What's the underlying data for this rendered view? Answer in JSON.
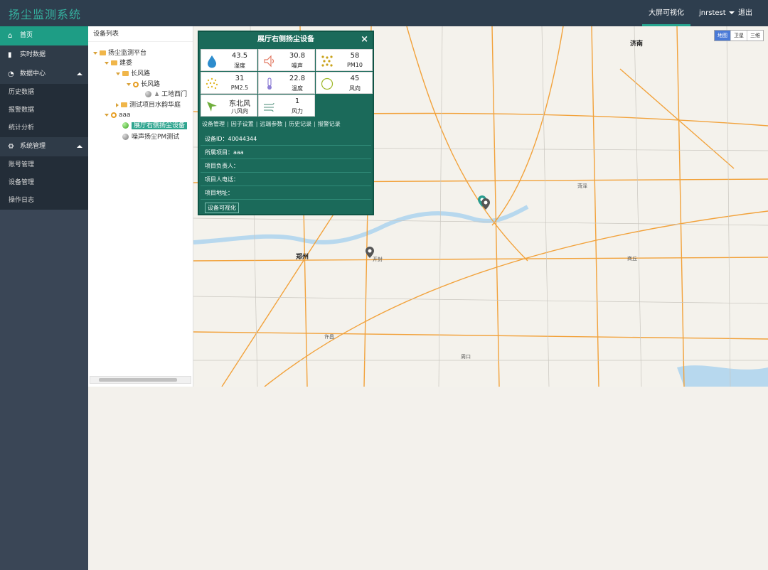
{
  "app": {
    "title": "扬尘监测系统"
  },
  "top": {
    "screen": "大屏可视化",
    "user": "jnrstest",
    "logout": "退出"
  },
  "sidebar": {
    "items": [
      {
        "label": "首页",
        "icon": "home-icon",
        "active": true
      },
      {
        "label": "实时数据",
        "icon": "bar-chart-icon"
      },
      {
        "label": "数据中心",
        "icon": "pie-chart-icon",
        "group": true
      },
      {
        "label": "历史数据",
        "sub": true
      },
      {
        "label": "报警数据",
        "sub": true
      },
      {
        "label": "统计分析",
        "sub": true
      },
      {
        "label": "系统管理",
        "icon": "gear-icon",
        "group": true
      },
      {
        "label": "账号管理",
        "sub": true
      },
      {
        "label": "设备管理",
        "sub": true
      },
      {
        "label": "操作日志",
        "sub": true
      }
    ]
  },
  "devices": {
    "title": "设备列表",
    "tree": [
      "扬尘监测平台",
      "建委",
      "长风路",
      "长风路",
      "工地西门",
      "测试项目水韵华庭",
      "aaa",
      "展厅右侧扬尘设备",
      "噪声扬尘PM测试"
    ]
  },
  "popup": {
    "title": "展厅右侧扬尘设备",
    "close": "×",
    "metrics": [
      {
        "value": "43.5",
        "label": "湿度",
        "icon": "water-drop-icon"
      },
      {
        "value": "30.8",
        "label": "噪声",
        "icon": "speaker-icon"
      },
      {
        "value": "58",
        "label": "PM10",
        "icon": "particles-icon"
      },
      {
        "value": "31",
        "label": "PM2.5",
        "icon": "dust-icon"
      },
      {
        "value": "22.8",
        "label": "温度",
        "icon": "thermometer-icon"
      },
      {
        "value": "45",
        "label": "风向",
        "icon": "compass-icon"
      },
      {
        "value": "东北风",
        "label": "八风向",
        "icon": "wind-arrow-icon"
      },
      {
        "value": "1",
        "label": "风力",
        "icon": "wind-icon"
      }
    ],
    "tabs": [
      "设备管理",
      "因子设置",
      "远端参数",
      "历史记录",
      "报警记录"
    ],
    "info": {
      "device_id": "设备ID：40044344",
      "project": "所属项目：aaa",
      "owner": "项目负责人：",
      "phone": "项目人电话：",
      "address": "项目地址："
    },
    "viz_button": "设备可视化"
  },
  "map": {
    "types": [
      "地图",
      "卫星",
      "三维"
    ],
    "labels": {
      "jinan": "济南",
      "zhengzhou": "郑州",
      "kaifeng": "开封",
      "shangqiu": "商丘",
      "heze": "菏泽",
      "xuchang": "许昌",
      "zhoukou": "周口"
    }
  }
}
